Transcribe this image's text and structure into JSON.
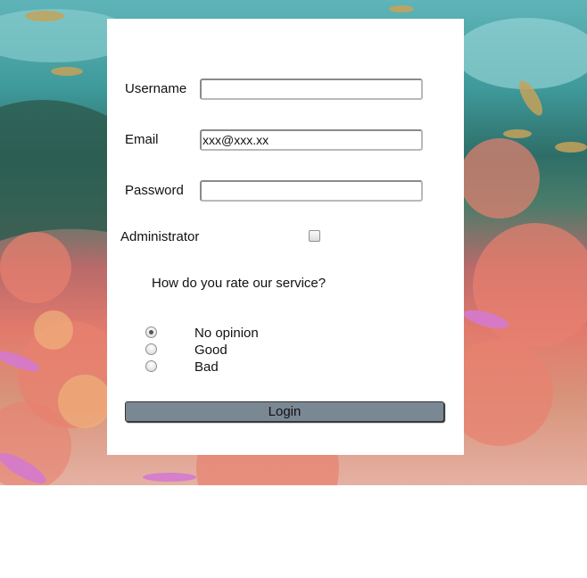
{
  "form": {
    "username": {
      "label": "Username",
      "value": ""
    },
    "email": {
      "label": "Email",
      "value": "xxx@xxx.xx"
    },
    "password": {
      "label": "Password",
      "value": ""
    },
    "administrator": {
      "label": "Administrator",
      "checked": false
    },
    "rating": {
      "question": "How do you rate our service?",
      "options": [
        {
          "label": "No opinion",
          "checked": true
        },
        {
          "label": "Good",
          "checked": false
        },
        {
          "label": "Bad",
          "checked": false
        }
      ]
    },
    "login_label": "Login"
  },
  "colors": {
    "panel_bg": "#ffffff",
    "button_bg": "#7a8894"
  }
}
